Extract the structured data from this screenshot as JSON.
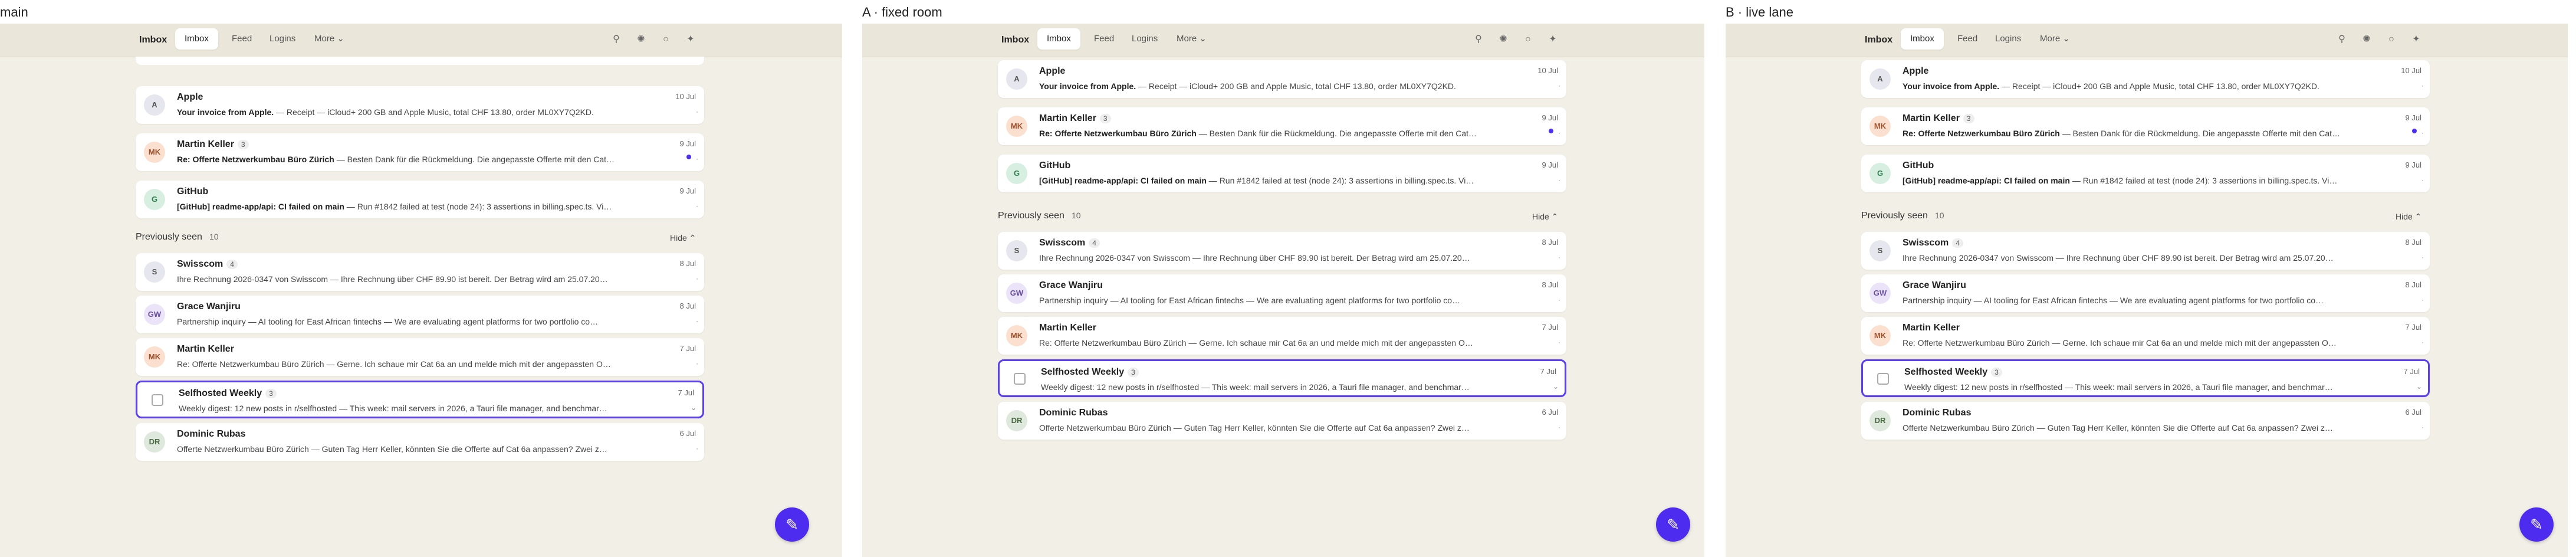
{
  "panels": [
    {
      "title": "main"
    },
    {
      "title": "A · fixed room"
    },
    {
      "title": "B · live lane"
    }
  ],
  "nav": {
    "brand": "Imbox",
    "tabs": [
      "Imbox",
      "Feed",
      "Logins",
      "More ⌄"
    ]
  },
  "new_messages": [
    {
      "initials": "A",
      "sender": "Apple",
      "count": "",
      "subject": "Your invoice from Apple.",
      "preview": " — Receipt — iCloud+ 200 GB and Apple Music, total CHF 13.80, order ML0XY7Q2KD.",
      "date": "10 Jul",
      "avatar_bg": "#e6e6ee",
      "avatar_fg": "#555"
    },
    {
      "initials": "MK",
      "sender": "Martin Keller",
      "count": "3",
      "subject": "Re: Offerte Netzwerkumbau Büro Zürich",
      "preview": " — Besten Dank für die Rückmeldung. Die angepasste Offerte mit den Cat…",
      "date": "9 Jul",
      "avatar_bg": "#fbe0cf",
      "avatar_fg": "#a0522d",
      "unread": true
    },
    {
      "initials": "G",
      "sender": "GitHub",
      "count": "",
      "subject": "[GitHub] readme-app/api: CI failed on main",
      "preview": " — Run #1842 failed at test (node 24): 3 assertions in billing.spec.ts. Vi…",
      "date": "9 Jul",
      "avatar_bg": "#d6efe0",
      "avatar_fg": "#2e7d4f"
    }
  ],
  "previously_seen": {
    "title": "Previously seen",
    "count": "10",
    "hide_label": "Hide ⌃",
    "messages": [
      {
        "initials": "S",
        "sender": "Swisscom",
        "count": "4",
        "subject": "",
        "preview": "Ihre Rechnung 2026-0347 von Swisscom — Ihre Rechnung über CHF 89.90 ist bereit. Der Betrag wird am 25.07.20…",
        "date": "8 Jul",
        "avatar_bg": "#e6e6ee",
        "avatar_fg": "#555"
      },
      {
        "initials": "GW",
        "sender": "Grace Wanjiru",
        "count": "",
        "subject": "",
        "preview": "Partnership inquiry — AI tooling for East African fintechs — We are evaluating agent platforms for two portfolio co…",
        "date": "8 Jul",
        "avatar_bg": "#ebe3f7",
        "avatar_fg": "#6a4fa0"
      },
      {
        "initials": "MK",
        "sender": "Martin Keller",
        "count": "",
        "subject": "",
        "preview": "Re: Offerte Netzwerkumbau Büro Zürich — Gerne. Ich schaue mir Cat 6a an und melde mich mit der angepassten O…",
        "date": "7 Jul",
        "avatar_bg": "#fbe0cf",
        "avatar_fg": "#a0522d"
      },
      {
        "initials": "",
        "sender": "Selfhosted Weekly",
        "count": "3",
        "subject": "",
        "preview": "Weekly digest: 12 new posts in r/selfhosted — This week: mail servers in 2026, a Tauri file manager, and benchmar…",
        "date": "7 Jul",
        "avatar_bg": "#ffffff",
        "avatar_fg": "#555",
        "selected": true
      },
      {
        "initials": "DR",
        "sender": "Dominic Rubas",
        "count": "",
        "subject": "",
        "preview": "Offerte Netzwerkumbau Büro Zürich — Guten Tag Herr Keller, könnten Sie die Offerte auf Cat 6a anpassen? Zwei z…",
        "date": "6 Jul",
        "avatar_bg": "#dfe8dc",
        "avatar_fg": "#4a6a44"
      }
    ]
  },
  "compose_icon": "pencil-icon"
}
